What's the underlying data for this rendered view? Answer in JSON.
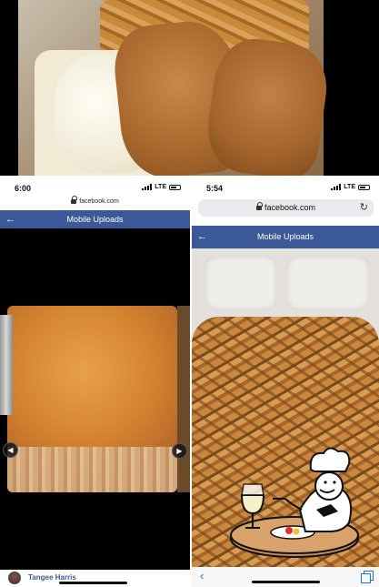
{
  "left_screen": {
    "status_time": "6:00",
    "network": "LTE",
    "url": "facebook.com",
    "header_title": "Mobile Uploads",
    "author_name": "Tangee Harris",
    "icons": [
      "back-arrow-icon",
      "previous-photo-icon",
      "next-photo-icon",
      "lock-icon"
    ]
  },
  "right_screen": {
    "status_time": "5:54",
    "network": "LTE",
    "url": "facebook.com",
    "header_title": "Mobile Uploads",
    "icons": [
      "back-arrow-icon",
      "reload-icon",
      "lock-icon",
      "safari-back-icon",
      "tabs-icon"
    ]
  },
  "glyphs": {
    "back": "←",
    "prev": "◀",
    "next": "▶",
    "reload": "↻",
    "safari_back": "‹"
  },
  "colors": {
    "facebook_blue": "#3b5998",
    "ios_blue": "#1a73e8"
  },
  "badge": {
    "icon": "chef-dining-icon"
  }
}
